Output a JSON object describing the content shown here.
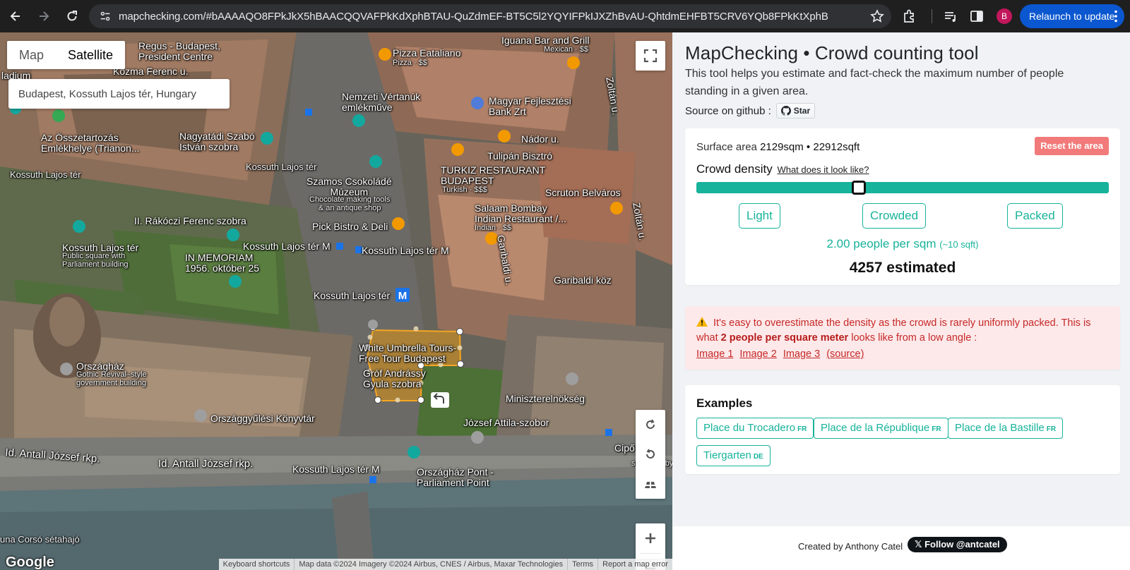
{
  "browser": {
    "url": "mapchecking.com/#bAAAAQO8FPkJkX5hBAACQQVAFPkKdXphBTAU-QuZdmEF-BT5C5l2YQYIFPkIJXZhBvAU-QhtdmEHFBT5CRV6YQb8FPkKtXphB",
    "relaunch_label": "Relaunch to update",
    "profile_initial": "B"
  },
  "map": {
    "type_controls": [
      "Map",
      "Satellite"
    ],
    "active_type": "Satellite",
    "search_value": "Budapest, Kossuth Lajos tér, Hungary",
    "labels": {
      "regus": "Regus - Budapest,\nPresident Centre",
      "kozma": "Kozma Ferenc u.",
      "ladium": "ladium",
      "pizza": "Pizza Eataliano",
      "pizza_sub": "Pizza · $$",
      "iguana": "Iguana Bar and Grill",
      "iguana_sub": "Mexican · $$",
      "nemzeti": "Nemzeti Vértanúk\nemlékműve",
      "magyar": "Magyar Fejlesztési\nBank Zrt",
      "nador": "Nádor u.",
      "zoltan1": "Zoltán u.",
      "osszetartozas": "Az Összetartozás\nEmlékhelye (Trianon...",
      "nagyatadi": "Nagyatádi Szabó\nIstván szobra",
      "tulipan": "Tulipán Bisztró",
      "turkiz": "TURKIZ RESTAURANT\nBUDAPEST",
      "turkiz_sub": "Turkish · $$$",
      "kossuth1": "Kossuth Lajos tér",
      "kossuth2": "Kossuth Lajos tér",
      "szamos": "Szamos Csokoládé\nMúzeum",
      "szamos_sub": "Chocolate making tools\n& an antique shop",
      "scruton": "Scruton Belváros",
      "salaam": "Salaam Bombay\nIndian Restaurant /...",
      "salaam_sub": "Indian · $$",
      "zoltan2": "Zoltán u.",
      "rakoczi": "II. Rákóczi Ferenc szobra",
      "pick": "Pick Bistro & Deli",
      "kossuth_park": "Kossuth Lajos tér",
      "kossuth_park_sub": "Public square with\nParliament building",
      "kossuth_m1": "Kossuth Lajos tér M",
      "kossuth_m2": "Kossuth Lajos tér M",
      "memoriam": "IN MEMORIAM\n1956. október 25",
      "garibaldi_u": "Garibaldi u.",
      "garibaldi_koz": "Garibaldi köz",
      "kossuth_metro": "Kossuth Lajos tér",
      "white_umbrella": "White Umbrella Tours-\nFree Tour Budapest",
      "grof": "Gróf Andrássy\nGyula szobra",
      "orszaghaz": "Országház",
      "orszaghaz_sub": "Gothic Revival–style\ngovernment building",
      "miniszter": "Miniszterelnökség",
      "jozsef": "József Attila-szobor",
      "konyvtar": "Országgyűlési Könyvtár",
      "antall1": "Id. Antall József rkp.",
      "antall2": "Id. Antall József rkp.",
      "kossuth_m3": "Kossuth Lajos tér M",
      "orszaghaz_pont": "Országház Pont -\nParliament Point",
      "cipo": "Cipő",
      "sculpture": "sculpture by",
      "corso": "una Corsó sétahajó"
    },
    "attribution": [
      "Keyboard shortcuts",
      "Map data ©2024 Imagery ©2024 Airbus, CNES / Airbus, Maxar Technologies",
      "Terms",
      "Report a map error"
    ],
    "google_logo": "Google"
  },
  "panel": {
    "title": "MapChecking • Crowd counting tool",
    "description": "This tool helps you estimate and fact-check the maximum number of people standing in a given area.",
    "source_label": "Source on github :",
    "github_star": "Star",
    "surface_label": "Surface area",
    "surface_value": "2129sqm • 22912sqft",
    "reset_label": "Reset the area",
    "density_label": "Crowd density",
    "density_link": "What does it look like?",
    "density_fraction": 0.39,
    "density_buttons": [
      "Light",
      "Crowded",
      "Packed"
    ],
    "per_sqm": "2.00 people per sqm",
    "per_sqm_sub": "(~10 sqft)",
    "estimate": "4257 estimated",
    "warning_icon": "warning-icon",
    "warning_text_1": "It's easy to overestimate the density as the crowd is rarely uniformly packed. This is what",
    "warning_bold": "2 people per square meter",
    "warning_text_2": "looks like from a low angle :",
    "warning_links": [
      "Image 1",
      "Image 2",
      "Image 3",
      "(source)"
    ],
    "examples_title": "Examples",
    "examples": [
      {
        "name": "Place du Trocadero",
        "code": "FR"
      },
      {
        "name": "Place de la République",
        "code": "FR"
      },
      {
        "name": "Place de la Bastille",
        "code": "FR"
      },
      {
        "name": "Tiergarten",
        "code": "DE"
      }
    ],
    "credit": "Created by Anthony Catel",
    "follow": "Follow @antcatel"
  },
  "colors": {
    "accent": "#17b39a",
    "danger_bg": "#fde9ea",
    "danger_text": "#c62828",
    "reset_bg": "#f27a7a",
    "polygon_fill": "#c08a2a",
    "polygon_stroke": "#f5a623"
  }
}
